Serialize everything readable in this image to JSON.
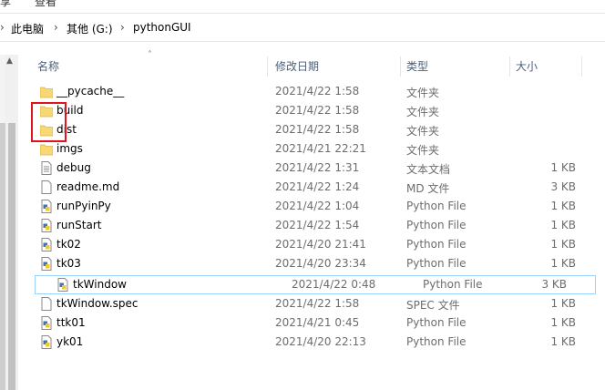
{
  "ribbon": {
    "left_label": "享",
    "view_label": "查看"
  },
  "breadcrumb": {
    "items": [
      {
        "label": "此电脑"
      },
      {
        "label": "其他 (G:)"
      },
      {
        "label": "pythonGUI"
      }
    ],
    "separator": "›"
  },
  "columns": {
    "name": "名称",
    "date": "修改日期",
    "type": "类型",
    "size": "大小"
  },
  "files": [
    {
      "name": "__pycache__",
      "date": "2021/4/22 1:58",
      "type": "文件夹",
      "size": "",
      "icon": "folder-icon"
    },
    {
      "name": "build",
      "date": "2021/4/22 1:58",
      "type": "文件夹",
      "size": "",
      "icon": "folder-icon"
    },
    {
      "name": "dist",
      "date": "2021/4/22 1:58",
      "type": "文件夹",
      "size": "",
      "icon": "folder-icon"
    },
    {
      "name": "imgs",
      "date": "2021/4/21 22:21",
      "type": "文件夹",
      "size": "",
      "icon": "folder-icon"
    },
    {
      "name": "debug",
      "date": "2021/4/22 1:31",
      "type": "文本文档",
      "size": "1 KB",
      "icon": "text-file-icon"
    },
    {
      "name": "readme.md",
      "date": "2021/4/22 1:24",
      "type": "MD 文件",
      "size": "3 KB",
      "icon": "blank-file-icon"
    },
    {
      "name": "runPyinPy",
      "date": "2021/4/22 1:04",
      "type": "Python File",
      "size": "1 KB",
      "icon": "python-file-icon"
    },
    {
      "name": "runStart",
      "date": "2021/4/22 1:54",
      "type": "Python File",
      "size": "1 KB",
      "icon": "python-file-icon"
    },
    {
      "name": "tk02",
      "date": "2021/4/20 21:41",
      "type": "Python File",
      "size": "1 KB",
      "icon": "python-file-icon"
    },
    {
      "name": "tk03",
      "date": "2021/4/20 23:34",
      "type": "Python File",
      "size": "1 KB",
      "icon": "python-file-icon"
    },
    {
      "name": "tkWindow",
      "date": "2021/4/22 0:48",
      "type": "Python File",
      "size": "3 KB",
      "icon": "python-file-icon"
    },
    {
      "name": "tkWindow.spec",
      "date": "2021/4/22 1:58",
      "type": "SPEC 文件",
      "size": "1 KB",
      "icon": "blank-file-icon"
    },
    {
      "name": "ttk01",
      "date": "2021/4/21 0:45",
      "type": "Python File",
      "size": "1 KB",
      "icon": "python-file-icon"
    },
    {
      "name": "yk01",
      "date": "2021/4/20 22:13",
      "type": "Python File",
      "size": "1 KB",
      "icon": "python-file-icon"
    }
  ],
  "colors": {
    "header_text": "#4c607a",
    "detail_text": "#6d6d6d",
    "selection_border": "#99d1ff",
    "annotation_red": "#e0141e",
    "folder_yellow": "#f8d775"
  }
}
